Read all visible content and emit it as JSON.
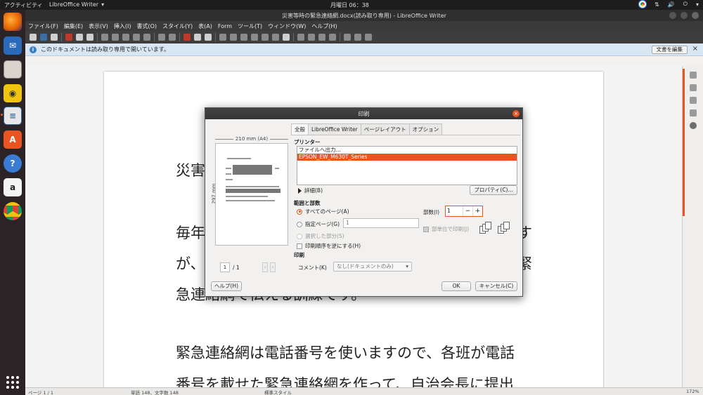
{
  "topbar": {
    "activities": "アクティビティ",
    "app_name": "LibreOffice Writer",
    "clock": "月曜日 06：38"
  },
  "window": {
    "title": "災害等時の緊急連絡網.docx(読み取り専用) - LibreOffice Writer"
  },
  "menu": [
    "ファイル(F)",
    "編集(E)",
    "表示(V)",
    "挿入(I)",
    "書式(O)",
    "スタイル(Y)",
    "表(A)",
    "Form",
    "ツール(T)",
    "ウィンドウ(W)",
    "ヘルプ(H)"
  ],
  "infobar": {
    "message": "このドキュメントは読み取り専用で開いています。",
    "edit_button": "文書を編集",
    "close": "×"
  },
  "document": {
    "lines": [
      "災害",
      "毎年",
      "が、",
      "急連絡網で伝える訓練です。",
      "緊急連絡網は電話番号を使いますので、各班が電話",
      "番号を載せた緊急連絡網を作って、自治会長に提出"
    ],
    "right_fragments": [
      "す",
      "緊"
    ]
  },
  "statusbar": {
    "page": "ページ 1 / 1",
    "words": "単語 148、文字数 148",
    "style": "標準スタイル",
    "zoom": "172%"
  },
  "dialog": {
    "title": "印刷",
    "preview": {
      "width_label": "210 mm (A4)",
      "height_label": "297 mm",
      "page_current": "1",
      "page_total": "/ 1"
    },
    "tabs": [
      "全般",
      "LibreOffice Writer",
      "ページレイアウト",
      "オプション"
    ],
    "printer_section": "プリンター",
    "printers": [
      "ファイルへ出力...",
      "EPSON_EW_M630T_Series"
    ],
    "details_label": "詳細(B)",
    "properties_button": "プロパティ(C)...",
    "range_section": "範囲と部数",
    "range_options": {
      "all": "すべてのページ(A)",
      "pages": "指定ページ(G)",
      "pages_value": "1",
      "selection": "選択した部分(S)",
      "reverse": "印刷順序を逆にする(H)"
    },
    "copies": {
      "label": "部数(I)",
      "value": "1",
      "minus": "−",
      "plus": "+",
      "collate": "部単位で印刷(J)"
    },
    "print_section": "印刷",
    "comment_label": "コメント(K)",
    "comment_value": "なし(ドキュメントのみ)",
    "help_button": "ヘルプ(H)",
    "ok_button": "OK",
    "cancel_button": "キャンセル(C)"
  }
}
